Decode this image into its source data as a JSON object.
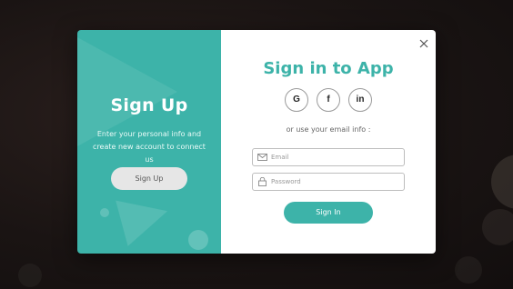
{
  "left_panel": {
    "title": "Sign Up",
    "description": "Enter your personal info and create new account to connect us",
    "button_label": "Sign Up"
  },
  "right_panel": {
    "title": "Sign in to App",
    "social": [
      {
        "label": "G",
        "icon": "google-icon"
      },
      {
        "label": "f",
        "icon": "facebook-icon"
      },
      {
        "label": "in",
        "icon": "linkedin-icon"
      }
    ],
    "or_text": "or use your email info :",
    "email": {
      "placeholder": "Email",
      "value": ""
    },
    "password": {
      "placeholder": "Password",
      "value": ""
    },
    "button_label": "Sign In"
  },
  "colors": {
    "accent": "#3db3a9",
    "backdrop": "#1a1413"
  }
}
